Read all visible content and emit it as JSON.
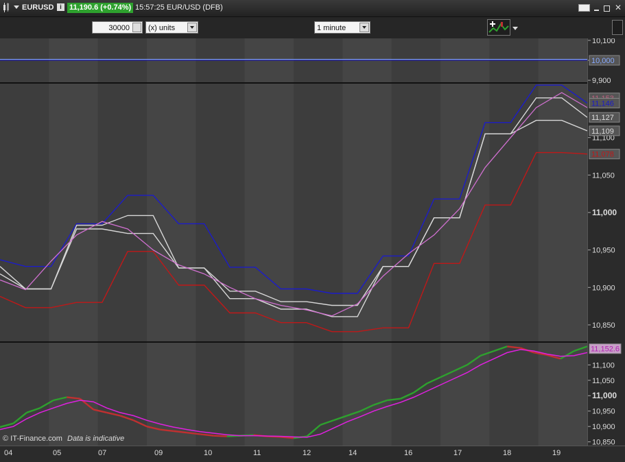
{
  "title_bar": {
    "symbol": "EURUSD",
    "price_change": "11,190.6 (+0.74%)",
    "time_and_instrument": "15:57:25 EUR/USD (DFB)",
    "window_controls": [
      "keyboard-icon",
      "minimize-icon",
      "restore-icon",
      "close-icon"
    ]
  },
  "toolbar": {
    "quantity_value": "30000",
    "units_label": "(x) units",
    "timeframe_value": "1 minute"
  },
  "footer": {
    "source": "© IT-Finance.com",
    "note": "Data is indicative"
  },
  "colors": {
    "upper_line": "#1c1cc8",
    "lower_line": "#c01818",
    "middle_line": "#d8d8d8",
    "ma_line": "#d070d0",
    "histogram_ma": "#e020e0",
    "candle_up": "#2ea12e",
    "candle_down": "#c03030"
  },
  "chart_data": [
    {
      "type": "line",
      "panel": "top",
      "y_ticks": [
        "10,100",
        "10,000",
        "9,900"
      ],
      "label_10000": "10,000",
      "series": [
        {
          "values": [
            10000,
            10000
          ]
        },
        {
          "values": [
            10005,
            10005
          ]
        }
      ],
      "ylim": [
        9890,
        10110
      ]
    },
    {
      "type": "line",
      "panel": "main",
      "y_ticks": [
        "11,100",
        "11,050",
        "11,000",
        "10,950",
        "10,900",
        "10,850"
      ],
      "price_labels": [
        "11,153",
        "11,146",
        "11,127",
        "11,109",
        "11,078"
      ],
      "x_ticks": [
        "04",
        "05",
        "07",
        "09",
        "10",
        "11",
        "12",
        "14",
        "16",
        "17",
        "18",
        "19"
      ],
      "ylim": [
        10828,
        11172
      ],
      "series": [
        {
          "values": [
            10937,
            10928,
            10928,
            10985,
            10985,
            11023,
            11023,
            10985,
            10985,
            10927,
            10927,
            10898,
            10898,
            10892,
            10892,
            10942,
            10942,
            11018,
            11018,
            11120,
            11120,
            11170,
            11170,
            11146
          ]
        },
        {
          "values": [
            10888,
            10873,
            10873,
            10880,
            10880,
            10948,
            10948,
            10903,
            10903,
            10866,
            10866,
            10853,
            10853,
            10841,
            10841,
            10846,
            10846,
            10932,
            10932,
            11010,
            11010,
            11080,
            11080,
            11078
          ]
        },
        {
          "values": [
            10928,
            10898,
            10898,
            10983,
            10983,
            10996,
            10996,
            10926,
            10926,
            10895,
            10895,
            10881,
            10881,
            10876,
            10876,
            10928,
            10928,
            10993,
            10993,
            11105,
            11105,
            11153,
            11153,
            11127
          ]
        },
        {
          "values": [
            10918,
            10898,
            10898,
            10978,
            10978,
            10972,
            10972,
            10926,
            10926,
            10885,
            10885,
            10871,
            10871,
            10861,
            10861,
            10928,
            10928,
            10993,
            10993,
            11105,
            11105,
            11123,
            11123,
            11109
          ]
        },
        {
          "values": [
            10910,
            10897,
            10935,
            10970,
            10988,
            10978,
            10950,
            10930,
            10918,
            10900,
            10885,
            10876,
            10870,
            10862,
            10878,
            10915,
            10945,
            10970,
            11005,
            11060,
            11100,
            11140,
            11160,
            11140
          ]
        }
      ]
    },
    {
      "type": "area",
      "panel": "bottom",
      "y_ticks": [
        "11,100",
        "11,050",
        "11,000",
        "10,950",
        "10,900",
        "10,850"
      ],
      "last_label": "11,152.6",
      "ylim": [
        10838,
        11172
      ],
      "series": [
        {
          "values": [
            10898,
            10910,
            10945,
            10960,
            10985,
            10995,
            10990,
            10955,
            10945,
            10935,
            10920,
            10900,
            10890,
            10885,
            10880,
            10875,
            10870,
            10868,
            10870,
            10872,
            10868,
            10866,
            10862,
            10868,
            10905,
            10920,
            10935,
            10950,
            10970,
            10985,
            10990,
            11010,
            11040,
            11060,
            11080,
            11100,
            11130,
            11145,
            11160,
            11155,
            11140,
            11132,
            11120,
            11145,
            11160
          ]
        },
        {
          "values": [
            10890,
            10900,
            10925,
            10945,
            10960,
            10975,
            10985,
            10980,
            10960,
            10945,
            10935,
            10920,
            10908,
            10898,
            10890,
            10883,
            10878,
            10873,
            10870,
            10870,
            10869,
            10868,
            10866,
            10865,
            10875,
            10895,
            10915,
            10932,
            10950,
            10965,
            10978,
            10995,
            11015,
            11035,
            11055,
            11075,
            11100,
            11120,
            11140,
            11150,
            11145,
            11135,
            11128,
            11130,
            11140
          ]
        }
      ]
    }
  ]
}
